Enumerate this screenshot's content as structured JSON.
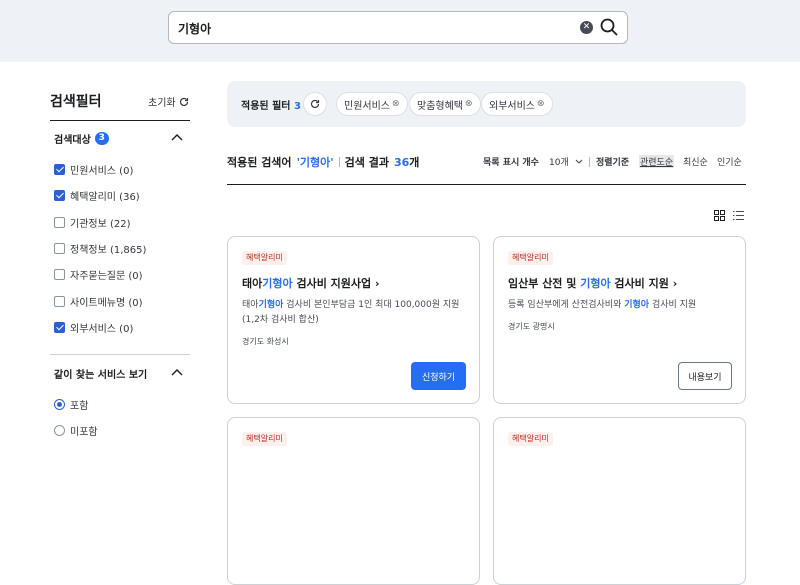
{
  "search": {
    "value": "기형아"
  },
  "sidebar": {
    "title": "검색필터",
    "reset": "초기화",
    "group1": {
      "label": "검색대상",
      "count": "3",
      "items": [
        {
          "label": "민원서비스 (0)",
          "checked": true
        },
        {
          "label": "혜택알리미 (36)",
          "checked": true
        },
        {
          "label": "기관정보 (22)",
          "checked": false
        },
        {
          "label": "정책정보 (1,865)",
          "checked": false
        },
        {
          "label": "자주묻는질문 (0)",
          "checked": false
        },
        {
          "label": "사이트메뉴명 (0)",
          "checked": false
        },
        {
          "label": "외부서비스 (0)",
          "checked": true
        }
      ]
    },
    "group2": {
      "label": "같이 찾는 서비스 보기",
      "items": [
        {
          "label": "포함",
          "selected": true
        },
        {
          "label": "미포함",
          "selected": false
        }
      ]
    }
  },
  "applied": {
    "label": "적용된 필터",
    "count": "3",
    "chips": [
      "민원서비스",
      "맞춤형혜택",
      "외부서비스"
    ]
  },
  "summary": {
    "prefix": "적용된 검색어",
    "term": "'기형아'",
    "result_label": "검색 결과",
    "result_count": "36",
    "result_unit": "개"
  },
  "options": {
    "per_page_label": "목록 표시 개수",
    "per_page": "10개",
    "sort_label": "정렬기준",
    "sorts": [
      "관련도순",
      "최신순",
      "인기순"
    ]
  },
  "cards": [
    {
      "tag": "혜택알리미",
      "title": [
        "태아",
        "기형아",
        " 검사비 지원사업"
      ],
      "desc": [
        "태아",
        "기형아",
        " 검사비 본인부담금 1인 최대 100,000원 지원 (1,2차 검사비 합산)"
      ],
      "region": "경기도 화성시",
      "button": "신청하기"
    },
    {
      "tag": "혜택알리미",
      "title": [
        "임산부 산전 및 ",
        "기형아",
        " 검사비 지원"
      ],
      "desc": [
        "등록 임산부에게 산전검사비와 ",
        "기형아",
        " 검사비 지원"
      ],
      "region": "경기도 광명시",
      "button": "내용보기"
    },
    {
      "tag": "혜택알리미"
    },
    {
      "tag": "혜택알리미"
    }
  ]
}
